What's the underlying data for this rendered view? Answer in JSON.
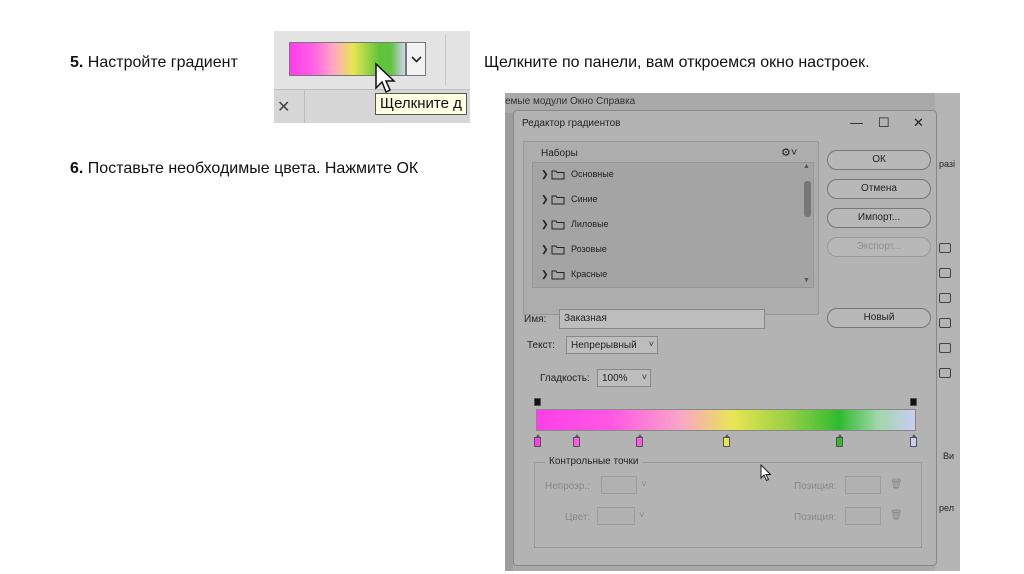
{
  "step5": {
    "num": "5.",
    "text": "Настройте градиент"
  },
  "hint": "Щелкните по панели, вам откроемся окно настроек.",
  "step6": {
    "num": "6.",
    "text": "Поставьте необходимые цвета. Нажмите ОК"
  },
  "mini": {
    "tooltip": "Щелкните д",
    "close_glyph": "✕"
  },
  "background": {
    "menu_text": "емые модули   Окно   Справка",
    "right_labels": [
      "разі",
      "Ви",
      "рел"
    ]
  },
  "dialog": {
    "title": "Редактор градиентов",
    "presets": {
      "title": "Наборы",
      "items": [
        "Основные",
        "Синие",
        "Лиловые",
        "Розовые",
        "Красные"
      ]
    },
    "buttons": {
      "ok": "ОК",
      "cancel": "Отмена",
      "import": "Импорт...",
      "export": "Экспорт...",
      "new": "Новый"
    },
    "name_label": "Имя:",
    "name_value": "Заказная",
    "type_label": "Текст:",
    "type_value": "Непрерывный",
    "smooth_label": "Гладкость:",
    "smooth_value": "100%",
    "color_stops": {
      "title": "Контрольные точки",
      "opacity_label": "Непрозр.:",
      "color_label": "Цвет:",
      "position_label": "Позиция:"
    }
  },
  "colors": {
    "stops": [
      "#ff3ee8",
      "#ff58e4",
      "#ff58e4",
      "#e8e552",
      "#2fbb2f",
      "#c9cdf1"
    ]
  }
}
